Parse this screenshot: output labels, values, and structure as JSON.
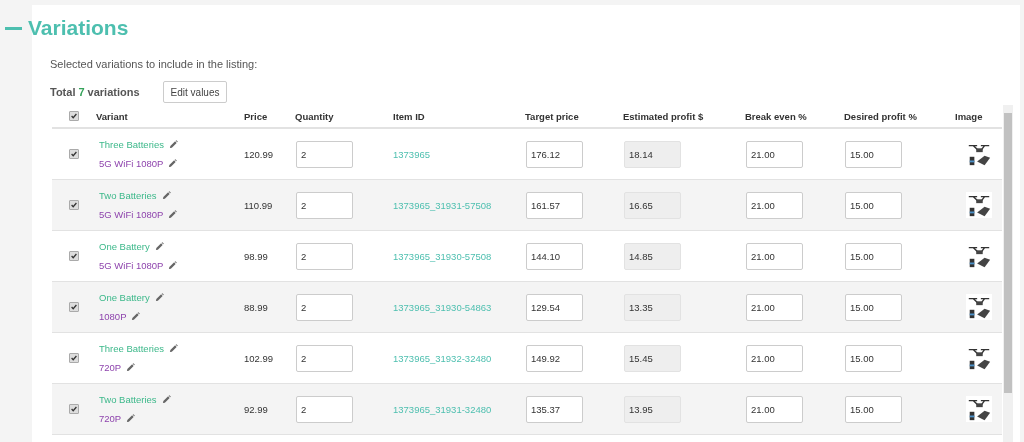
{
  "section": {
    "title": "Variations",
    "instruction": "Selected variations to include in the listing:"
  },
  "summary": {
    "label": "Total",
    "count": "7",
    "suffix": "variations"
  },
  "edit_button": "Edit values",
  "table": {
    "select_all_checked": true,
    "columns": [
      "Variant",
      "Price",
      "Quantity",
      "Item ID",
      "Target price",
      "Estimated profit $",
      "Break even %",
      "Desired profit %",
      "Image"
    ],
    "rows": [
      {
        "checked": true,
        "option_1": "Three Batteries",
        "option_2": "5G WiFi 1080P",
        "price": "120.99",
        "quantity": "2",
        "item_id": "1373965",
        "target_price": "176.12",
        "estimated_profit": "18.14",
        "break_even": "21.00",
        "desired_profit": "15.00"
      },
      {
        "checked": true,
        "option_1": "Two Batteries",
        "option_2": "5G WiFi 1080P",
        "price": "110.99",
        "quantity": "2",
        "item_id": "1373965_31931-57508",
        "target_price": "161.57",
        "estimated_profit": "16.65",
        "break_even": "21.00",
        "desired_profit": "15.00"
      },
      {
        "checked": true,
        "option_1": "One Battery",
        "option_2": "5G WiFi 1080P",
        "price": "98.99",
        "quantity": "2",
        "item_id": "1373965_31930-57508",
        "target_price": "144.10",
        "estimated_profit": "14.85",
        "break_even": "21.00",
        "desired_profit": "15.00"
      },
      {
        "checked": true,
        "option_1": "One Battery",
        "option_2": "1080P",
        "price": "88.99",
        "quantity": "2",
        "item_id": "1373965_31930-54863",
        "target_price": "129.54",
        "estimated_profit": "13.35",
        "break_even": "21.00",
        "desired_profit": "15.00"
      },
      {
        "checked": true,
        "option_1": "Three Batteries",
        "option_2": "720P",
        "price": "102.99",
        "quantity": "2",
        "item_id": "1373965_31932-32480",
        "target_price": "149.92",
        "estimated_profit": "15.45",
        "break_even": "21.00",
        "desired_profit": "15.00"
      },
      {
        "checked": true,
        "option_1": "Two Batteries",
        "option_2": "720P",
        "price": "92.99",
        "quantity": "2",
        "item_id": "1373965_31931-32480",
        "target_price": "135.37",
        "estimated_profit": "13.95",
        "break_even": "21.00",
        "desired_profit": "15.00"
      }
    ]
  }
}
